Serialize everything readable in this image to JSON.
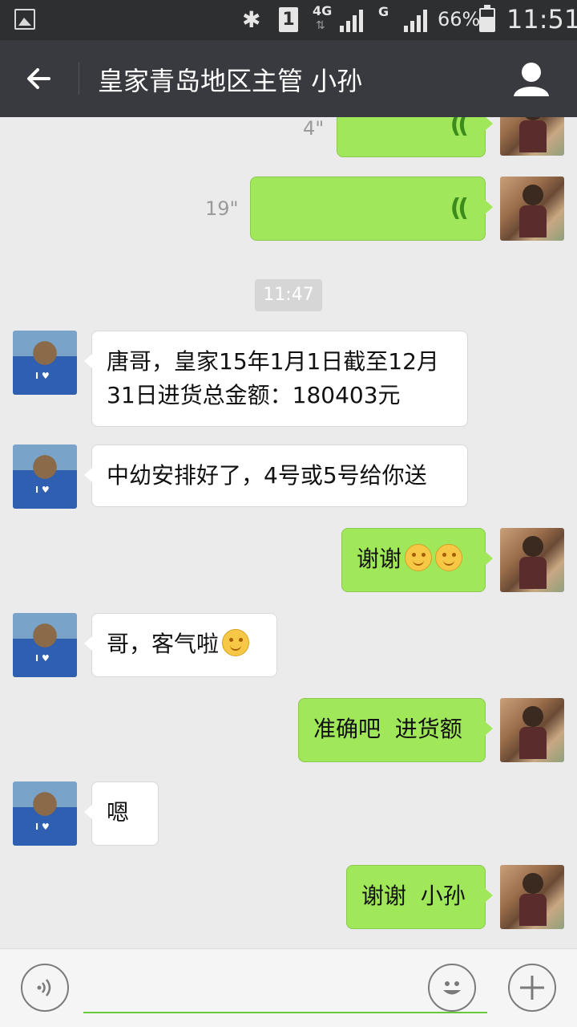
{
  "status_bar": {
    "carrier_1": "1",
    "network_1": "4G",
    "network_2": "G",
    "battery": "66%",
    "time": "11:51"
  },
  "header": {
    "title": "皇家青岛地区主管 小孙"
  },
  "messages": [
    {
      "side": "out",
      "type": "voice",
      "duration": "4\""
    },
    {
      "side": "out",
      "type": "voice",
      "duration": "19\""
    },
    {
      "type": "time",
      "text": "11:47"
    },
    {
      "side": "in",
      "type": "text",
      "text": "唐哥，皇家15年1月1日截至12月31日进货总金额：180403元"
    },
    {
      "side": "in",
      "type": "text",
      "text": "中幼安排好了，4号或5号给你送"
    },
    {
      "side": "out",
      "type": "text",
      "text": "谢谢"
    },
    {
      "side": "in",
      "type": "text",
      "text": "哥，客气啦"
    },
    {
      "side": "out",
      "type": "text",
      "text": "准确吧  进货额"
    },
    {
      "side": "in",
      "type": "text",
      "text": "嗯"
    },
    {
      "side": "out",
      "type": "text",
      "text": "谢谢  小孙"
    }
  ],
  "icons": {
    "back": "arrow-left-icon",
    "profile": "person-icon",
    "voice": "voice-icon",
    "emoji": "emoji-icon",
    "plus": "plus-icon"
  },
  "colors": {
    "header_bg": "#393a3f",
    "chat_bg": "#ebebeb",
    "out_bubble": "#a0e75a",
    "in_bubble": "#ffffff"
  }
}
